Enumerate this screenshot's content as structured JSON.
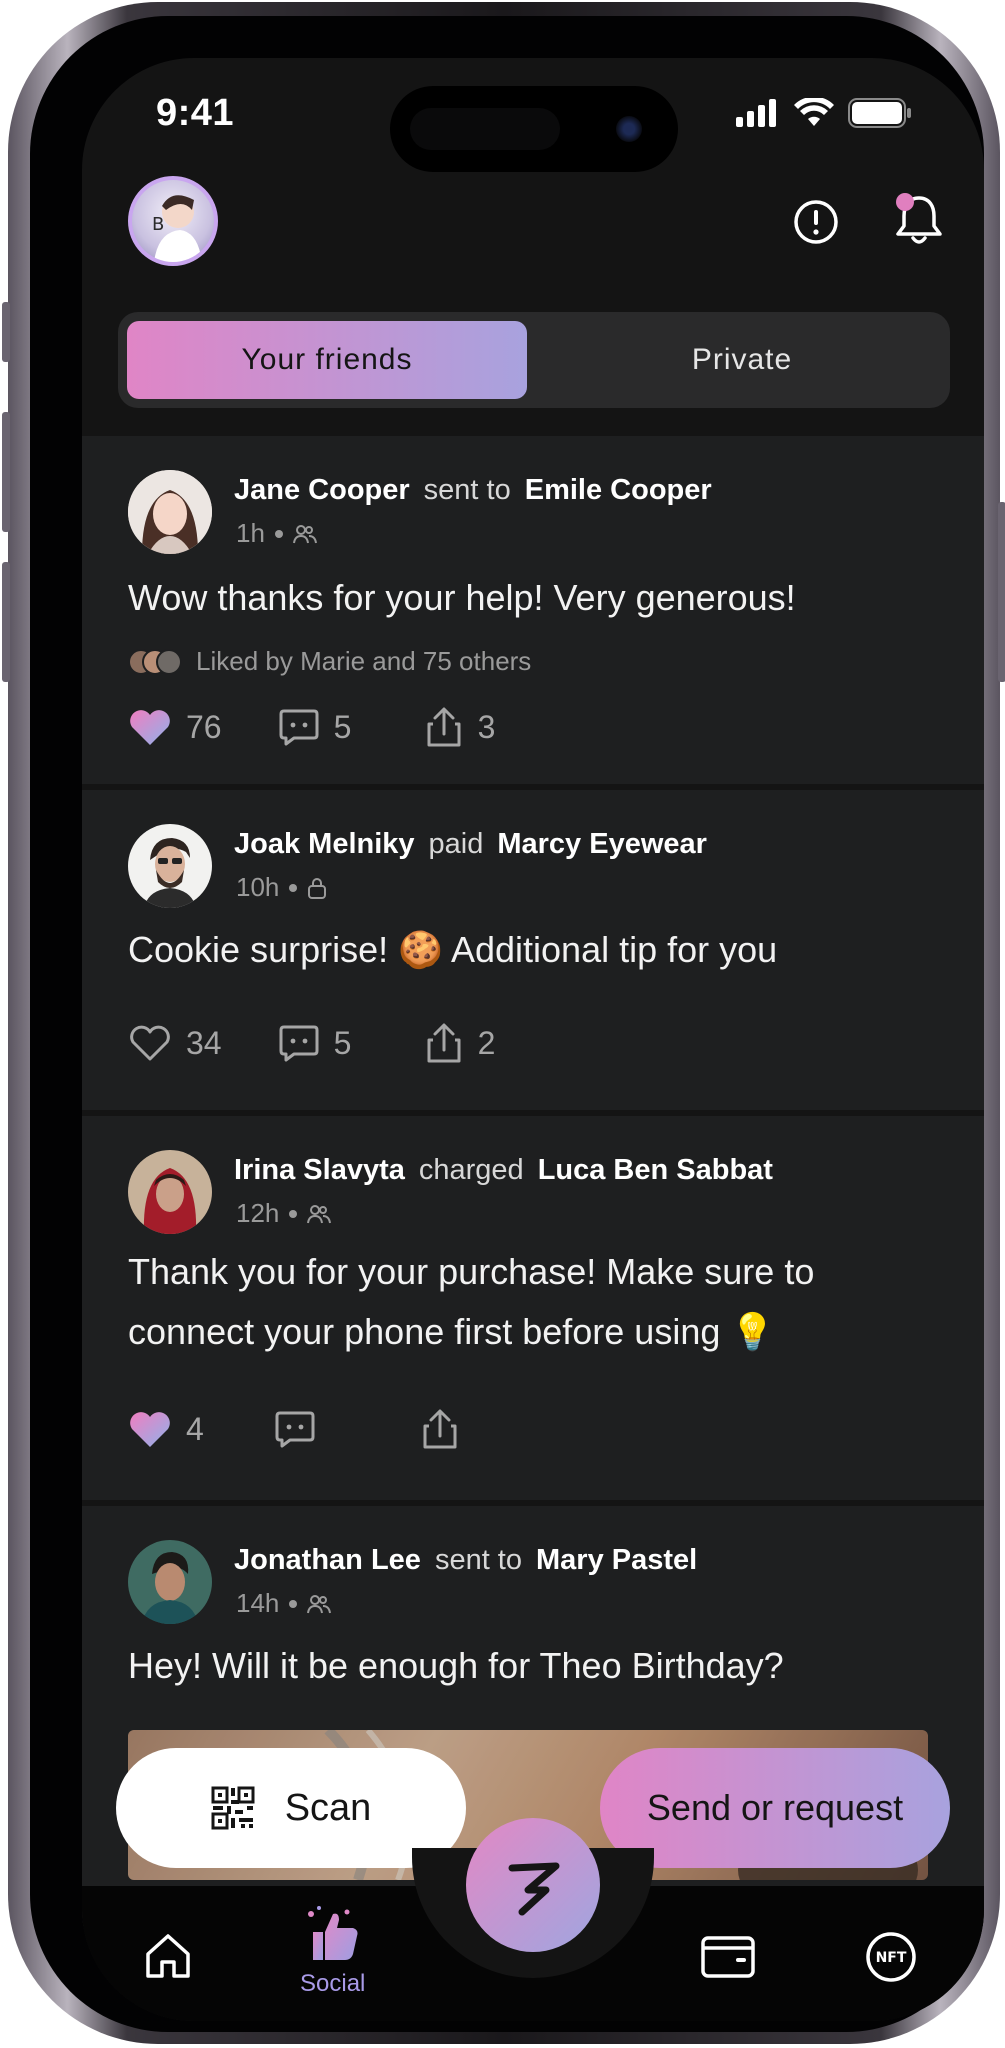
{
  "status_bar": {
    "time": "9:41"
  },
  "header": {
    "avatar_initial": "B"
  },
  "segmented": {
    "active": "Your friends",
    "inactive": "Private"
  },
  "posts": [
    {
      "sender": "Jane Cooper",
      "verb": "sent to",
      "recipient": "Emile Cooper",
      "time": "1h",
      "privacy": "friends",
      "message": "Wow thanks for your help! Very generous!",
      "liked_by": "Liked by Marie and 75 others",
      "likes": "76",
      "liked": true,
      "comments": "5",
      "shares": "3"
    },
    {
      "sender": "Joak Melniky",
      "verb": "paid",
      "recipient": "Marcy Eyewear",
      "time": "10h",
      "privacy": "private",
      "message_before": "Cookie surprise!",
      "message_emoji": "🍪",
      "message_after": "Additional tip for you",
      "likes": "34",
      "liked": false,
      "comments": "5",
      "shares": "2"
    },
    {
      "sender": "Irina Slavyta",
      "verb": "charged",
      "recipient": "Luca Ben Sabbat",
      "time": "12h",
      "privacy": "friends",
      "message_line1": "Thank you for your purchase! Make sure to",
      "message_line2": "connect your phone first before using",
      "message_emoji": "💡",
      "likes": "4",
      "liked": true,
      "comments": "",
      "shares": ""
    },
    {
      "sender": "Jonathan Lee",
      "verb": "sent to",
      "recipient": "Mary Pastel",
      "time": "14h",
      "privacy": "friends",
      "message": "Hey! Will it be enough for Theo Birthday?"
    }
  ],
  "floating": {
    "scan_label": "Scan",
    "send_label": "Send or request"
  },
  "tabbar": {
    "social_label": "Social",
    "nft_label": "NFT"
  },
  "colors": {
    "accent_start": "#e085c6",
    "accent_end": "#a8a2de",
    "tab_active": "#a99be8"
  }
}
